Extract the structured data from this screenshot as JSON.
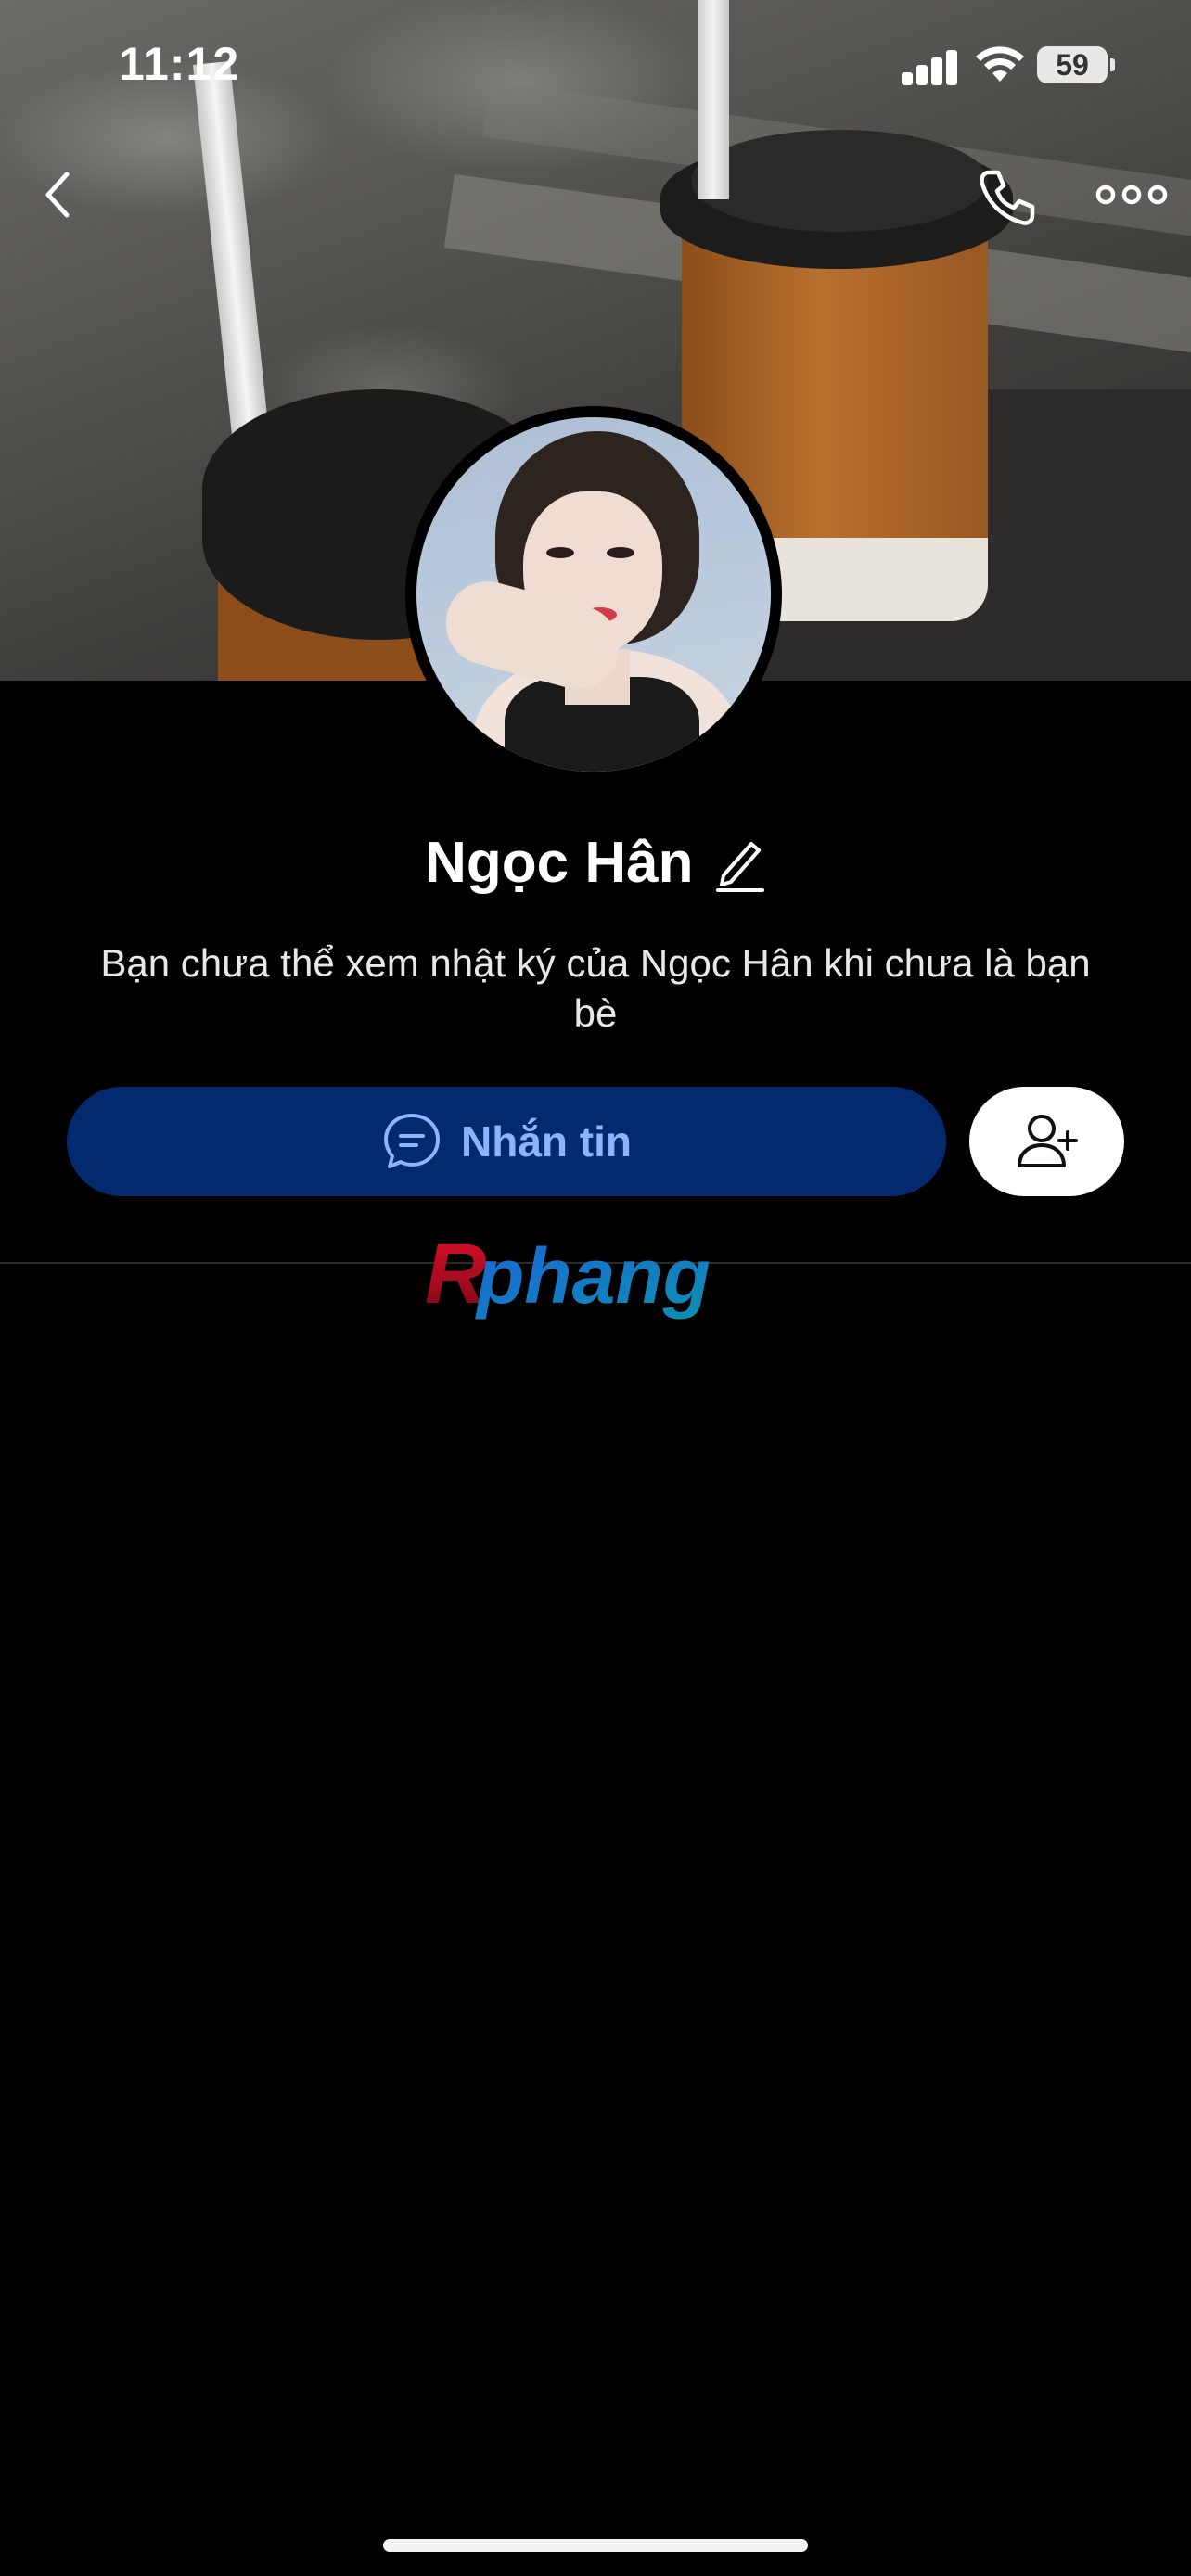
{
  "status_bar": {
    "time": "11:12",
    "battery": "59"
  },
  "profile": {
    "name": "Ngọc Hân",
    "notice": "Bạn chưa thể xem nhật ký của Ngọc Hân khi chưa là bạn bè"
  },
  "actions": {
    "message_label": "Nhắn tin"
  },
  "watermark": {
    "text": "Rphang"
  },
  "colors": {
    "message_button_bg": "#03296e",
    "message_button_text": "#8ab4ff",
    "background": "#000000"
  }
}
